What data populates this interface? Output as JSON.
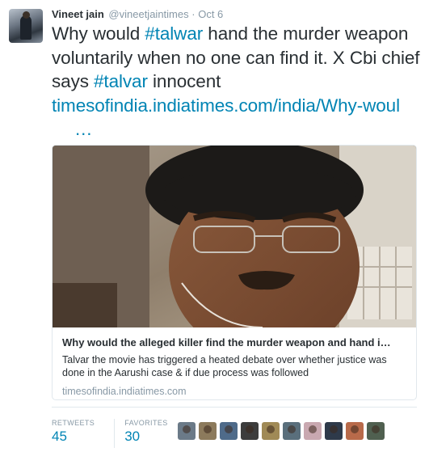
{
  "tweet": {
    "fullname": "Vineet jain",
    "handle": "@vineetjaintimes",
    "dot": "·",
    "time": "Oct 6",
    "text_1": "Why would ",
    "hashtag_1": "#talwar",
    "text_2": " hand the murder weapon voluntarily when no one can find it. X Cbi chief says ",
    "hashtag_2": "#talvar",
    "text_3": " innocent ",
    "link": "timesofindia.indiatimes.com/india/Why-woul",
    "link_ellipsis": "…"
  },
  "card": {
    "title": "Why would the alleged killer find the murder weapon and hand i…",
    "description": "Talvar the movie has triggered a heated debate over whether justice was done in the Aarushi case & if due process was followed",
    "domain": "timesofindia.indiatimes.com"
  },
  "stats": {
    "retweets_label": "RETWEETS",
    "retweets_count": "45",
    "favorites_label": "FAVORITES",
    "favorites_count": "30"
  },
  "favoriters": [
    {
      "color": "#6b7a88"
    },
    {
      "color": "#8c7a5c"
    },
    {
      "color": "#4f6b8a"
    },
    {
      "color": "#3d3d3d"
    },
    {
      "color": "#a08a56"
    },
    {
      "color": "#5a6f7c"
    },
    {
      "color": "#c9a8b0"
    },
    {
      "color": "#2e3a4a"
    },
    {
      "color": "#b86a4a"
    },
    {
      "color": "#506050"
    }
  ]
}
